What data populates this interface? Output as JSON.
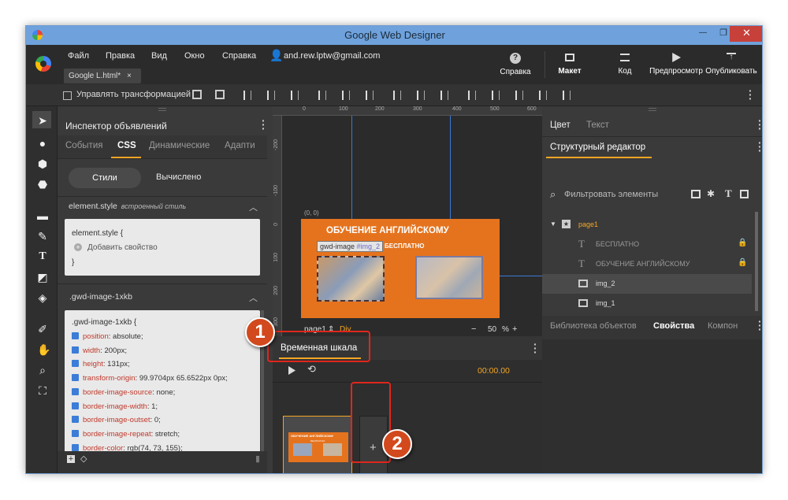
{
  "window": {
    "title": "Google Web Designer",
    "minimize": "—",
    "maximize": "❐",
    "close": "✕"
  },
  "menu": {
    "items": [
      "Файл",
      "Правка",
      "Вид",
      "Окно",
      "Справка"
    ],
    "user": "and.rew.lptw@gmail.com",
    "file_tab": "Google L.html*",
    "file_tab_close": "×"
  },
  "tools": {
    "help": "Справка",
    "layout": "Макет",
    "code": "Код",
    "preview": "Предпросмотр",
    "publish": "Опубликовать"
  },
  "toolbar": {
    "transform_label": "Управлять трансформацией"
  },
  "left_panel": {
    "title": "Инспектор объявлений",
    "tabs": [
      "События",
      "CSS",
      "Динамические",
      "Адапти"
    ],
    "active_tab": "CSS",
    "subtabs": {
      "styles": "Стили",
      "computed": "Вычислено"
    },
    "element_style": {
      "header": "element.style",
      "header_note": "встроенный стиль",
      "line1": "element.style {",
      "add": "Добавить свойство",
      "close": "}"
    },
    "gwd_image": {
      "header": ".gwd-image-1xkb",
      "selector": ".gwd-image-1xkb {",
      "props": [
        {
          "name": "position",
          "value": "absolute;"
        },
        {
          "name": "width",
          "value": "200px;"
        },
        {
          "name": "height",
          "value": "131px;"
        },
        {
          "name": "transform-origin",
          "value": "99.9704px 65.6522px 0px;"
        },
        {
          "name": "border-image-source",
          "value": "none;"
        },
        {
          "name": "border-image-width",
          "value": "1;"
        },
        {
          "name": "border-image-outset",
          "value": "0;"
        },
        {
          "name": "border-image-repeat",
          "value": "stretch;"
        },
        {
          "name": "border-color",
          "value": "rgb(74, 73, 155);"
        }
      ]
    }
  },
  "canvas": {
    "ruler_top": [
      "0",
      "100",
      "200",
      "300",
      "400",
      "500",
      "600"
    ],
    "ruler_left": [
      "-200",
      "-100",
      "0",
      "100",
      "200",
      "300"
    ],
    "origin": "(0, 0)",
    "banner_title": "ОБУЧЕНИЕ АНГЛИЙСКОМУ",
    "banner_sub": "БЕСПЛАТНО",
    "selection_label": "gwd-image",
    "selection_id": "#img_2",
    "page": "page1",
    "page_arrow": "⇕",
    "div": "Div",
    "zoom_minus": "−",
    "zoom": "50",
    "zoom_unit": "%",
    "zoom_plus": "+"
  },
  "timeline": {
    "title": "Временная шкала",
    "time": "00:00.00",
    "add": "+",
    "thumb_title": "ОБУЧЕНИЕ АНГЛИЙСКОМУ",
    "thumb_sub": "БЕСПЛАТНО"
  },
  "right_panel": {
    "tabs": [
      "Цвет",
      "Текст"
    ],
    "structure_title": "Структурный редактор",
    "filter_placeholder": "Фильтровать элементы",
    "tree": [
      {
        "label": "page1",
        "kind": "page"
      },
      {
        "label": "БЕСПЛАТНО",
        "kind": "text",
        "locked": true
      },
      {
        "label": "ОБУЧЕНИЕ АНГЛИЙСКОМУ",
        "kind": "text",
        "locked": true
      },
      {
        "label": "img_2",
        "kind": "image",
        "selected": true
      },
      {
        "label": "img_1",
        "kind": "image"
      }
    ],
    "bottom_tabs": [
      "Библиотека объектов",
      "Свойства",
      "Компон"
    ]
  },
  "callouts": {
    "one": "1",
    "two": "2"
  },
  "colors": {
    "accent": "#f5a623",
    "banner": "#e5731e",
    "titlebar": "#6fa2dc",
    "callout": "#d2491d"
  }
}
